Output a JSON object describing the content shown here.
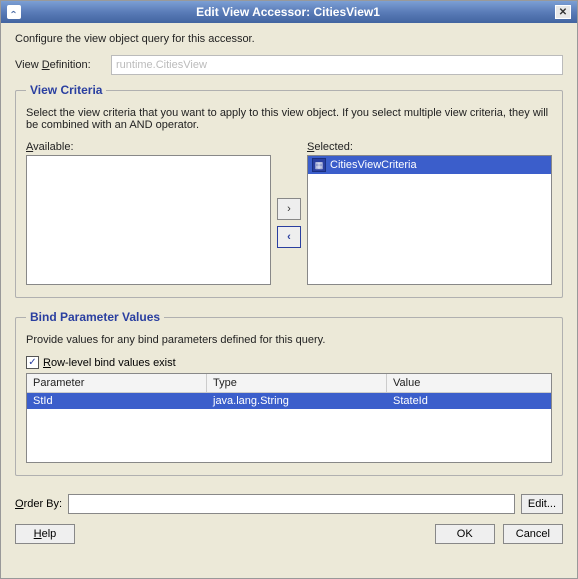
{
  "title": "Edit View Accessor: CitiesView1",
  "intro": "Configure the view object query for this accessor.",
  "viewDefinitionLabel": "View Definition:",
  "viewDefinitionValue": "runtime.CitiesView",
  "viewCriteria": {
    "legend": "View Criteria",
    "desc": "Select the view criteria that you want to apply to this view object. If you select multiple view criteria, they will be combined with an AND operator.",
    "availableLabel": "Available:",
    "selectedLabel": "Selected:",
    "selectedItems": [
      "CitiesViewCriteria"
    ]
  },
  "bind": {
    "legend": "Bind Parameter Values",
    "desc": "Provide values for any bind parameters defined for this query.",
    "checkboxLabel": "Row-level bind values exist",
    "checkboxChecked": "✓",
    "headers": {
      "parameter": "Parameter",
      "type": "Type",
      "value": "Value"
    },
    "rows": [
      {
        "parameter": "StId",
        "type": "java.lang.String",
        "value": "StateId"
      }
    ]
  },
  "orderByLabel": "Order By:",
  "editButton": "Edit...",
  "buttons": {
    "help": "Help",
    "ok": "OK",
    "cancel": "Cancel"
  }
}
